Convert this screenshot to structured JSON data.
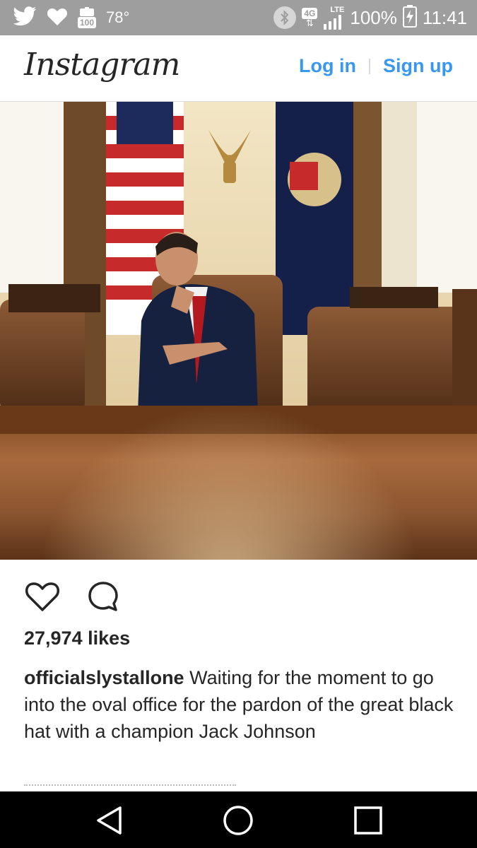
{
  "status_bar": {
    "left_icons": [
      "twitter-icon",
      "heart-icon",
      "battery-saver-icon"
    ],
    "battery_saver_label": "100",
    "temperature": "78°",
    "network": "4G",
    "network_type": "LTE",
    "battery": "100%",
    "time": "11:41"
  },
  "header": {
    "logo": "Instagram",
    "login": "Log in",
    "signup": "Sign up"
  },
  "post": {
    "likes": "27,974 likes",
    "username": "officialslystallone",
    "caption": "Waiting for the moment to go into the oval office for the pardon of the great black hat with a champion Jack Johnson"
  },
  "nav_bar": {
    "buttons": [
      "back-icon",
      "home-icon",
      "recents-icon"
    ]
  },
  "colors": {
    "link": "#3897f0",
    "text": "#262626",
    "status_bar": "#9e9e9e"
  }
}
